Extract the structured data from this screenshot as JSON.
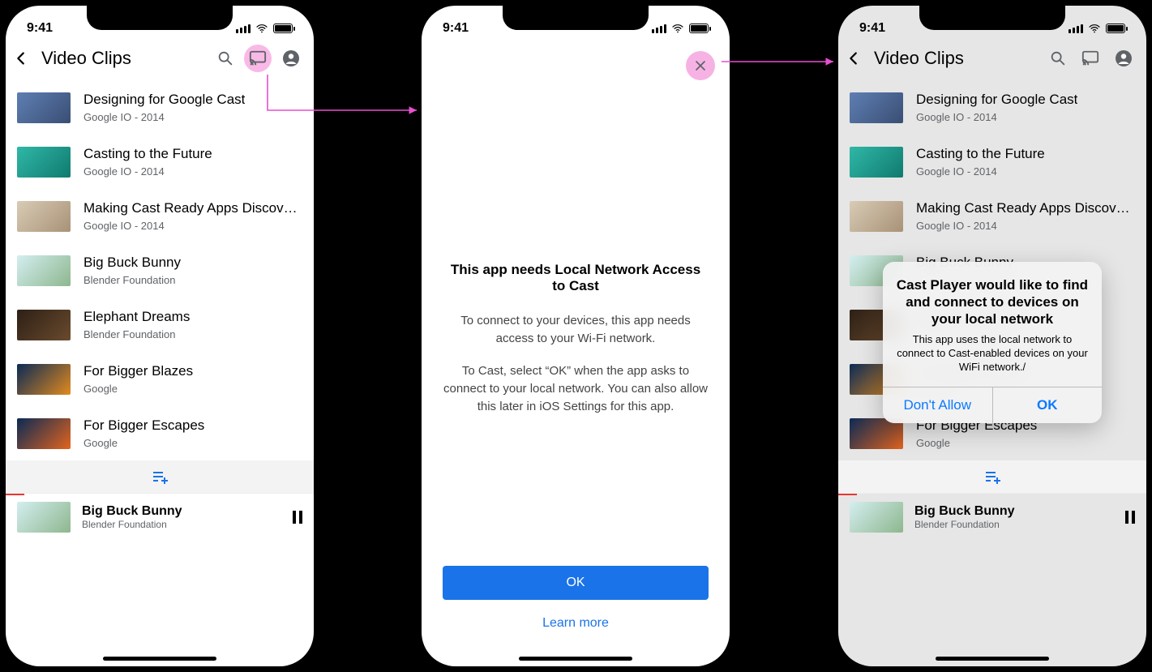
{
  "status": {
    "time": "9:41"
  },
  "page_title": "Video Clips",
  "videos": [
    {
      "title": "Designing for Google Cast",
      "sub": "Google IO - 2014"
    },
    {
      "title": "Casting to the Future",
      "sub": "Google IO - 2014"
    },
    {
      "title": "Making Cast Ready Apps Discover...",
      "sub": "Google IO - 2014"
    },
    {
      "title": "Big Buck Bunny",
      "sub": "Blender Foundation"
    },
    {
      "title": "Elephant Dreams",
      "sub": "Blender Foundation"
    },
    {
      "title": "For Bigger Blazes",
      "sub": "Google"
    },
    {
      "title": "For Bigger Escapes",
      "sub": "Google"
    }
  ],
  "mini_player": {
    "title": "Big Buck Bunny",
    "sub": "Blender Foundation"
  },
  "interstitial": {
    "title": "This app needs Local Network Access to Cast",
    "p1": "To connect to your devices, this app needs access to your Wi-Fi network.",
    "p2": "To Cast, select “OK” when the app asks to connect to your local network. You can also allow this later in iOS Settings for this app.",
    "ok": "OK",
    "learn": "Learn more"
  },
  "alert": {
    "title": "Cast Player would like to find and connect to devices on your local network",
    "message": "This app uses the local network to connect to Cast-enabled devices on your WiFi network./",
    "deny": "Don't Allow",
    "allow": "OK"
  }
}
